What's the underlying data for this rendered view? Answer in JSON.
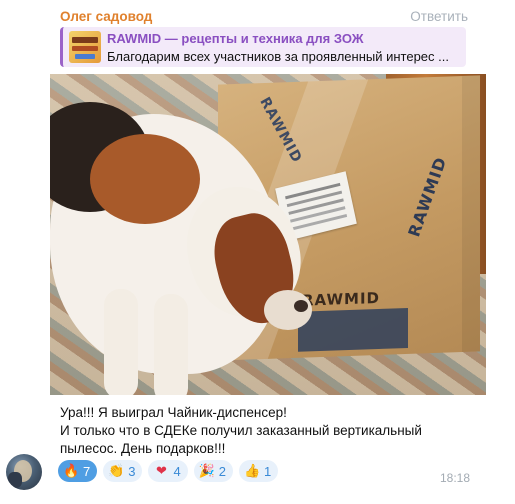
{
  "message": {
    "sender": "Олег садовод",
    "reply_label": "Ответить",
    "quote": {
      "title": "RAWMID — рецепты и техника для ЗОЖ",
      "text": "Благодарим всех участников за проявленный интерес ..."
    },
    "photo": {
      "box_text_1": "RAWMID",
      "box_text_2": "RAWMID",
      "box_text_3": "RAWMID"
    },
    "caption_lines": [
      "Ура!!! Я выиграл Чайник-диспенсер!",
      "И только что в СДЕКе получил заказанный вертикальный",
      "пылесос. День подарков!!!"
    ],
    "reactions": [
      {
        "emoji": "🔥",
        "count": "7",
        "active": true
      },
      {
        "emoji": "👏",
        "count": "3",
        "active": false
      },
      {
        "emoji": "❤",
        "count": "4",
        "active": false
      },
      {
        "emoji": "🎉",
        "count": "2",
        "active": false
      },
      {
        "emoji": "👍",
        "count": "1",
        "active": false
      }
    ],
    "time": "18:18"
  }
}
